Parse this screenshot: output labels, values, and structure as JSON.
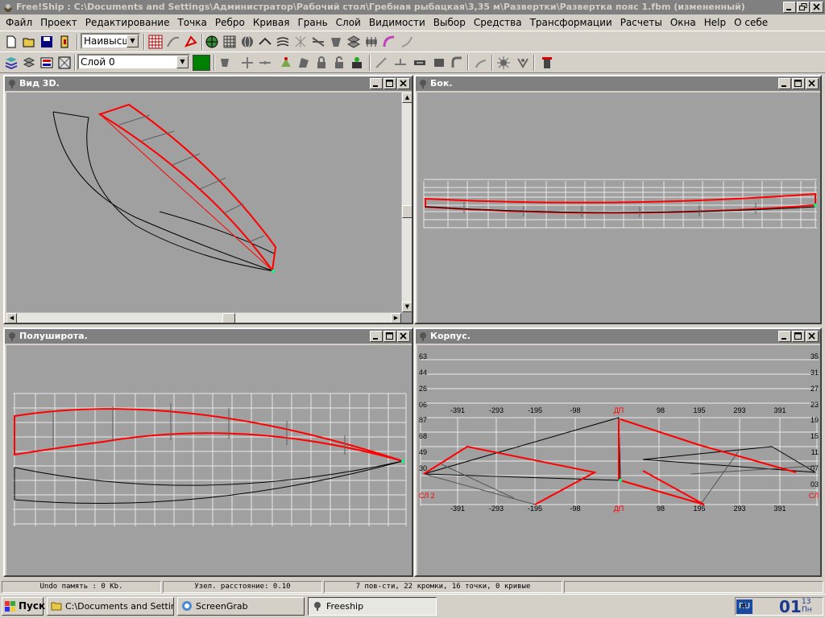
{
  "window": {
    "title": "Free!Ship : C:\\Documents and Settings\\Администратор\\Рабочий стол\\Гребная рыбацкая\\3,35 м\\Развертки\\Развертка пояс 1.fbm (измененный)"
  },
  "menu": [
    "Файл",
    "Проект",
    "Редактирование",
    "Точка",
    "Ребро",
    "Кривая",
    "Грань",
    "Слой",
    "Видимости",
    "Выбор",
    "Средства",
    "Трансформации",
    "Расчеты",
    "Окна",
    "Help",
    "О себе"
  ],
  "toolbar1": {
    "precision": "Наивысш."
  },
  "toolbar2": {
    "layer": "Слой 0",
    "layer_color": "#008000"
  },
  "viewports": {
    "v3d": {
      "title": "Вид 3D."
    },
    "side": {
      "title": "Бок."
    },
    "plan": {
      "title": "Полуширота."
    },
    "body": {
      "title": "Корпус.",
      "left_ticks": [
        "63",
        "44",
        "26",
        "06",
        "87",
        "68",
        "49",
        "30"
      ],
      "right_ticks": [
        "35",
        "31",
        "27",
        "23",
        "19",
        "15",
        "11",
        "07",
        "03"
      ],
      "x_ticks": [
        "-391",
        "-293",
        "-195",
        "-98",
        "ДП",
        "98",
        "195",
        "293",
        "391"
      ],
      "lbl_dp": "ДП",
      "lbl_wl_left": "СЛ 2",
      "lbl_wl_right": "СЛ"
    }
  },
  "status": {
    "undo": "Undo память : 0 Kb.",
    "distance": "Узел. расстояние: 0.10",
    "info": "7 пов-сти, 22 кромки, 16 точки, 0 кривые"
  },
  "taskbar": {
    "start": "Пуск",
    "tasks": [
      "C:\\Documents and Settin...",
      "ScreenGrab",
      "Freeship"
    ],
    "lang": "RU",
    "clock": "01",
    "clock_sub": "13",
    "day": "Пн"
  },
  "colors": {
    "accent": "#ff0000",
    "grid": "#ffffff",
    "hull": "#000000"
  }
}
